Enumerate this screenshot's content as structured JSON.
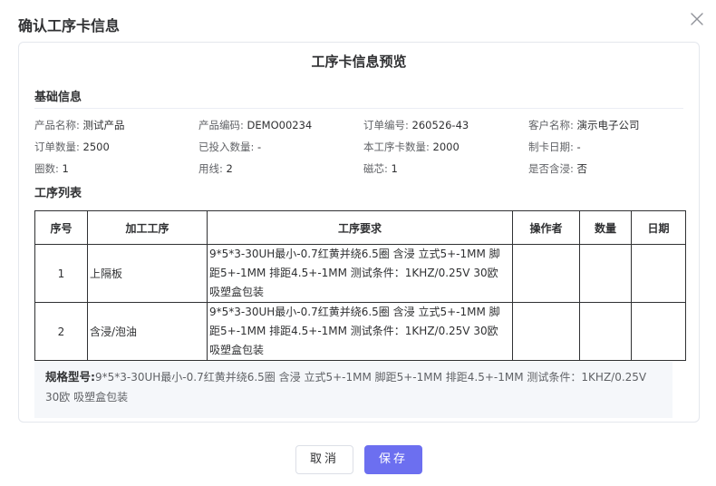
{
  "dialog": {
    "title": "确认工序卡信息",
    "close_icon": "close-icon"
  },
  "card": {
    "title": "工序卡信息预览"
  },
  "basic": {
    "title": "基础信息",
    "fields": [
      {
        "label": "产品名称:",
        "value": "测试产品"
      },
      {
        "label": "产品编码:",
        "value": "DEMO00234"
      },
      {
        "label": "订单编号:",
        "value": "260526-43"
      },
      {
        "label": "客户名称:",
        "value": "演示电子公司"
      },
      {
        "label": "订单数量:",
        "value": "2500"
      },
      {
        "label": "已投入数量:",
        "value": "-"
      },
      {
        "label": "本工序卡数量:",
        "value": "2000"
      },
      {
        "label": "制卡日期:",
        "value": "-"
      },
      {
        "label": "圈数:",
        "value": "1"
      },
      {
        "label": "用线:",
        "value": "2"
      },
      {
        "label": "磁芯:",
        "value": "1"
      },
      {
        "label": "是否含浸:",
        "value": "否"
      }
    ]
  },
  "process": {
    "title": "工序列表",
    "headers": [
      "序号",
      "加工工序",
      "工序要求",
      "操作者",
      "数量",
      "日期"
    ],
    "rows": [
      {
        "idx": "1",
        "name": "上隔板",
        "req": "9*5*3-30UH最小-0.7红黄并绕6.5圈 含浸 立式5+-1MM 脚距5+-1MM 排距4.5+-1MM 测试条件：1KHZ/0.25V 30欧 吸塑盒包装",
        "operator": "",
        "qty": "",
        "date": ""
      },
      {
        "idx": "2",
        "name": "含浸/泡油",
        "req": "9*5*3-30UH最小-0.7红黄并绕6.5圈 含浸 立式5+-1MM 脚距5+-1MM 排距4.5+-1MM 测试条件：1KHZ/0.25V 30欧 吸塑盒包装",
        "operator": "",
        "qty": "",
        "date": ""
      }
    ]
  },
  "spec": {
    "label": "规格型号:",
    "value": "9*5*3-30UH最小-0.7红黄并绕6.5圈 含浸 立式5+-1MM 脚距5+-1MM 排距4.5+-1MM 测试条件：1KHZ/0.25V 30欧 吸塑盒包装"
  },
  "footer": {
    "cancel_label": "取消",
    "save_label": "保存"
  },
  "colors": {
    "primary": "#6c6ff0",
    "border": "#e4e7ed",
    "spec_bg": "#f5f7fa"
  }
}
